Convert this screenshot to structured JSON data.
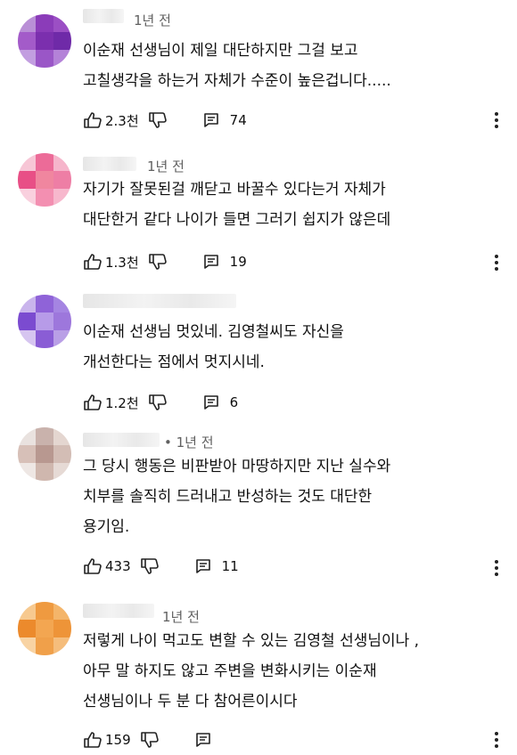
{
  "comments": [
    {
      "time": "1년 전",
      "lines": [
        "이순재 선생님이 제일 대단하지만 그걸 보고",
        "고칠생각을 하는거 자체가 수준이 높은겁니다....."
      ],
      "likes": "2.3천",
      "replies": "74",
      "avatar_colors": [
        "#b98fd6",
        "#8b3cb9",
        "#9b4fc4",
        "#a35bc9",
        "#7b2fae",
        "#6f2aa8",
        "#c29ee0",
        "#9a56c7",
        "#b482d8"
      ]
    },
    {
      "time": "1년 전",
      "lines": [
        "자기가 잘못된걸 깨닫고 바꿀수 있다는거 자체가",
        "대단한거 같다 나이가 들면 그러기 쉽지가 않은데"
      ],
      "likes": "1.3천",
      "replies": "19",
      "avatar_colors": [
        "#f7c6d6",
        "#ec6b98",
        "#f6b5cb",
        "#e84f86",
        "#f0869f",
        "#ee7ea5",
        "#f9d0de",
        "#f38fb1",
        "#f7b8cd"
      ]
    },
    {
      "time": "",
      "lines": [
        "이순재 선생님 멋있네. 김영철씨도 자신을",
        "개선한다는 점에서 멋지시네."
      ],
      "likes": "1.2천",
      "replies": "6",
      "avatar_colors": [
        "#c9b4ec",
        "#8f63d8",
        "#a585e2",
        "#7b4bd0",
        "#b79be8",
        "#9d77dc",
        "#d6c5f0",
        "#8a5dd5",
        "#b99fe6"
      ]
    },
    {
      "time": "• 1년 전",
      "lines": [
        "그 당시 행동은 비판받아 마땅하지만 지난 실수와",
        "치부를 솔직히 드러내고 반성하는 것도 대단한",
        "용기임."
      ],
      "likes": "433",
      "replies": "11",
      "avatar_colors": [
        "#e9e2df",
        "#c9b2ac",
        "#e4d6d0",
        "#d7c0b8",
        "#b89890",
        "#d3bdb5",
        "#eee7e4",
        "#cfb7ae",
        "#e6dad5"
      ]
    },
    {
      "time": "1년 전",
      "lines": [
        "저렇게 나이 먹고도 변할 수 있는 김영철 선생님이나 ,",
        "아무 말 하지도 않고 주변을 변화시키는 이순재",
        "선생님이나 두 분 다 참어른이시다"
      ],
      "likes": "159",
      "replies": "",
      "avatar_colors": [
        "#f7c98f",
        "#ef9a40",
        "#f4b56a",
        "#ec8a2c",
        "#f3a651",
        "#ee9438",
        "#f8d3a3",
        "#f0a04a",
        "#f5bd7c"
      ]
    }
  ]
}
